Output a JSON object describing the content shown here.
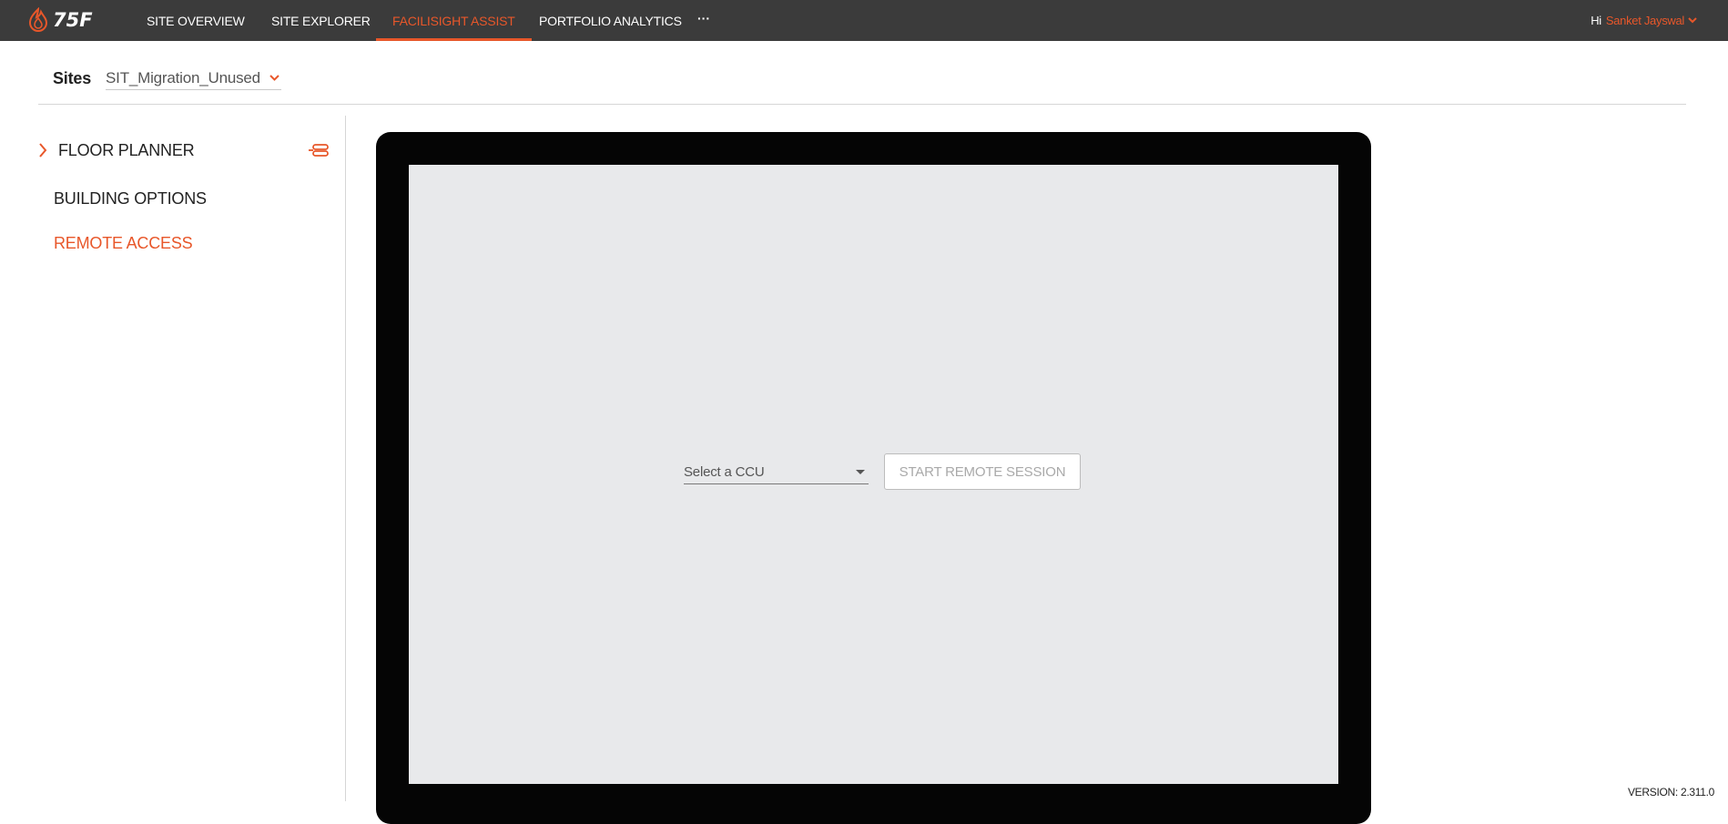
{
  "brand": {
    "logo_text": "75F"
  },
  "nav": {
    "items": [
      {
        "label": "SITE OVERVIEW",
        "active": false
      },
      {
        "label": "SITE EXPLORER",
        "active": false
      },
      {
        "label": "FACILISIGHT ASSIST",
        "active": true
      },
      {
        "label": "PORTFOLIO ANALYTICS",
        "active": false
      }
    ],
    "more_label": "···"
  },
  "user": {
    "greeting": "Hi",
    "name": "Sanket Jayswal"
  },
  "sites": {
    "label": "Sites",
    "selected": "SIT_Migration_Unused"
  },
  "sidebar": {
    "floor_planner": "FLOOR PLANNER",
    "building_options": "BUILDING OPTIONS",
    "remote_access": "REMOTE ACCESS"
  },
  "remote": {
    "ccu_placeholder": "Select a CCU",
    "start_button": "START REMOTE SESSION"
  },
  "footer": {
    "version": "VERSION: 2.311.0"
  },
  "colors": {
    "accent": "#e8572a",
    "topbar": "#3b3b3b",
    "screen": "#e8e9eb"
  }
}
